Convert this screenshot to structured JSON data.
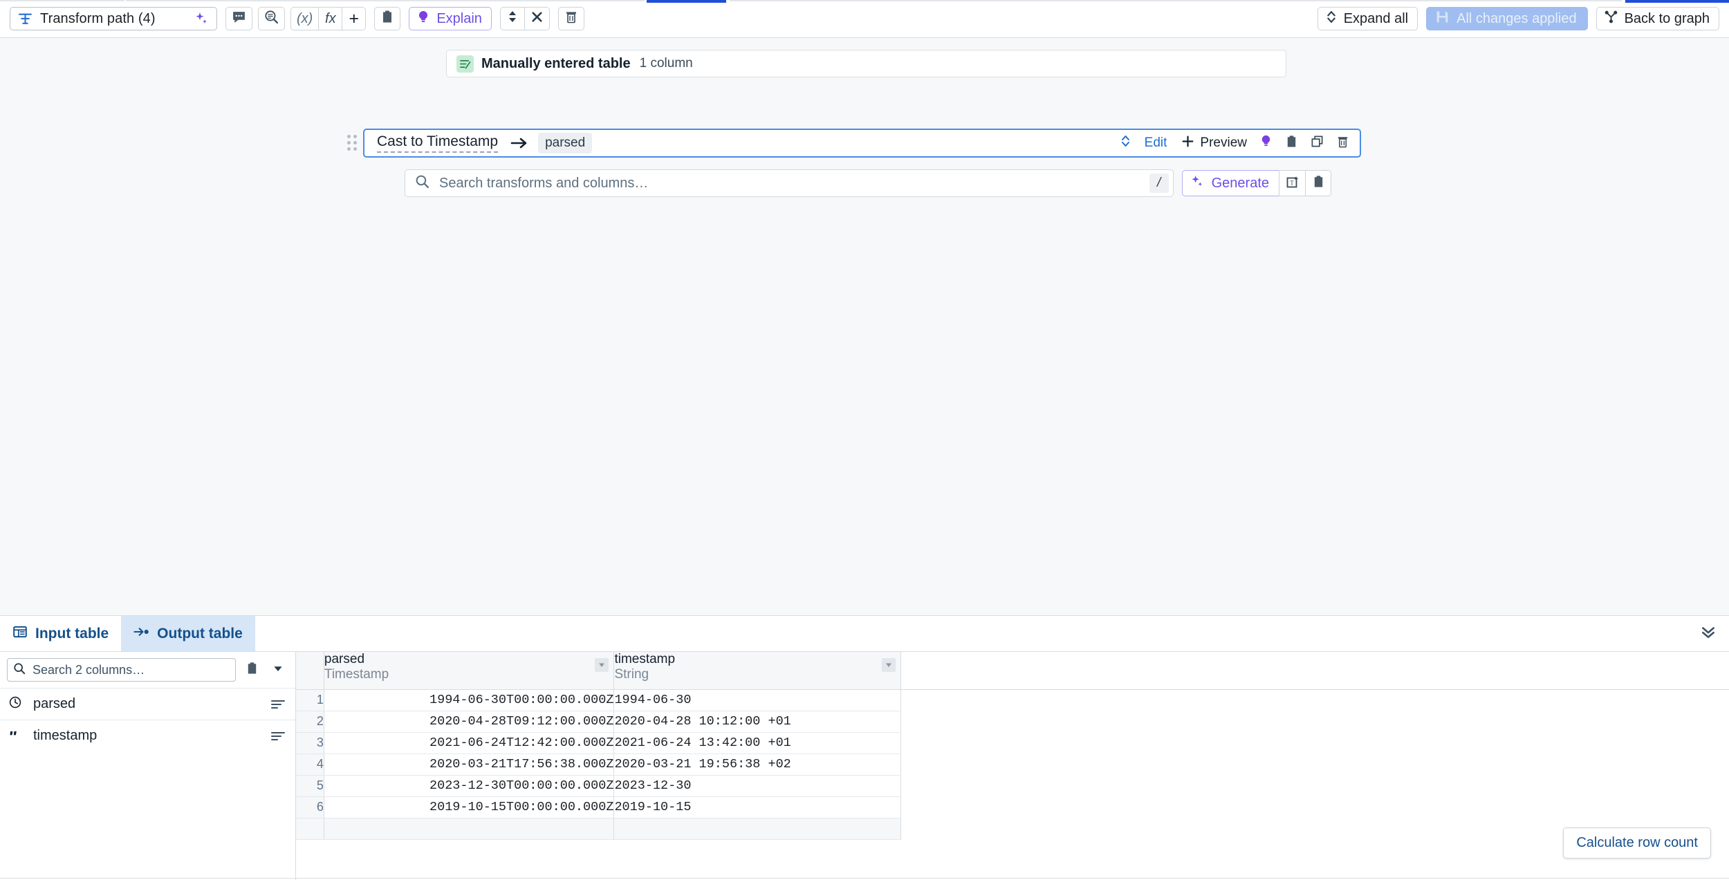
{
  "toolbar": {
    "path_label": "Transform path (4)",
    "path_icon": "transform-path-icon",
    "sparkle_icon": "sparkle-icon",
    "comment_icon": "comment-icon",
    "search_node_icon": "search-node-icon",
    "variable_icon": "(x)",
    "function_icon": "fx",
    "add_icon": "+",
    "clipboard_icon": "clipboard-icon",
    "explain_label": "Explain",
    "explain_icon": "lightbulb-icon",
    "expand_collapse_icon": "expand-collapse-icon",
    "close_icon": "close-icon",
    "delete_icon": "trash-icon",
    "expand_all_label": "Expand all",
    "expand_all_icon": "chevron-updown-icon",
    "changes_label": "All changes applied",
    "changes_icon": "save-icon",
    "back_to_graph_label": "Back to graph",
    "back_to_graph_icon": "graph-icon"
  },
  "canvas": {
    "source_node": {
      "icon": "manual-table-icon",
      "name": "Manually entered table",
      "meta": "1 column"
    },
    "transform": {
      "drag_handle_icon": "drag-handle-icon",
      "name": "Cast to Timestamp",
      "arrow_icon": "arrow-right-icon",
      "output_column": "parsed",
      "actions": {
        "reorder_icon": "chevron-updown-icon",
        "edit_label": "Edit",
        "preview_label": "Preview",
        "preview_icon": "plus-icon",
        "explain_icon": "lightbulb-icon",
        "copy_icon": "clipboard-icon",
        "duplicate_icon": "duplicate-icon",
        "delete_icon": "trash-icon"
      }
    },
    "search": {
      "icon": "search-icon",
      "placeholder": "Search transforms and columns…",
      "value": "",
      "shortcut": "/"
    },
    "generate": {
      "label": "Generate",
      "icon": "sparkle-icon",
      "new_node_icon": "new-text-node-icon",
      "paste_icon": "clipboard-icon"
    }
  },
  "panel": {
    "tabs": [
      {
        "label": "Input table",
        "icon": "input-table-icon",
        "active": false
      },
      {
        "label": "Output table",
        "icon": "output-table-icon",
        "active": true
      }
    ],
    "collapse_icon": "double-chevron-down-icon",
    "column_search": {
      "icon": "search-icon",
      "placeholder": "Search 2 columns…",
      "value": "",
      "copy_icon": "clipboard-icon",
      "dropdown_icon": "caret-down-icon"
    },
    "columns": [
      {
        "name": "parsed",
        "type_icon": "clock-icon",
        "sort_icon": "sort-icon"
      },
      {
        "name": "timestamp",
        "type_icon": "quote-icon",
        "sort_icon": "sort-icon"
      }
    ],
    "row_count_button": "Calculate row count"
  },
  "table_data": {
    "type": "table",
    "columns": [
      {
        "name": "parsed",
        "type": "Timestamp",
        "menu_icon": "caret-down-icon",
        "align": "right"
      },
      {
        "name": "timestamp",
        "type": "String",
        "menu_icon": "caret-down-icon",
        "align": "left"
      }
    ],
    "row_numbers": [
      "1",
      "2",
      "3",
      "4",
      "5",
      "6"
    ],
    "rows": [
      [
        "1994-06-30T00:00:00.000Z",
        "1994-06-30"
      ],
      [
        "2020-04-28T09:12:00.000Z",
        "2020-04-28 10:12:00 +01"
      ],
      [
        "2021-06-24T12:42:00.000Z",
        "2021-06-24 13:42:00 +01"
      ],
      [
        "2020-03-21T17:56:38.000Z",
        "2020-03-21 19:56:38 +02"
      ],
      [
        "2023-12-30T00:00:00.000Z",
        "2023-12-30"
      ],
      [
        "2019-10-15T00:00:00.000Z",
        "2019-10-15"
      ]
    ]
  },
  "colors": {
    "accent_blue": "#1f4fd8",
    "link_blue": "#14508c",
    "purple": "#6b4ee6",
    "selected_border": "#4a8ce8",
    "applied_bg": "#9fbdf0",
    "tab_active_bg": "#d6e6f7",
    "source_icon_bg": "#c7ebd4"
  }
}
